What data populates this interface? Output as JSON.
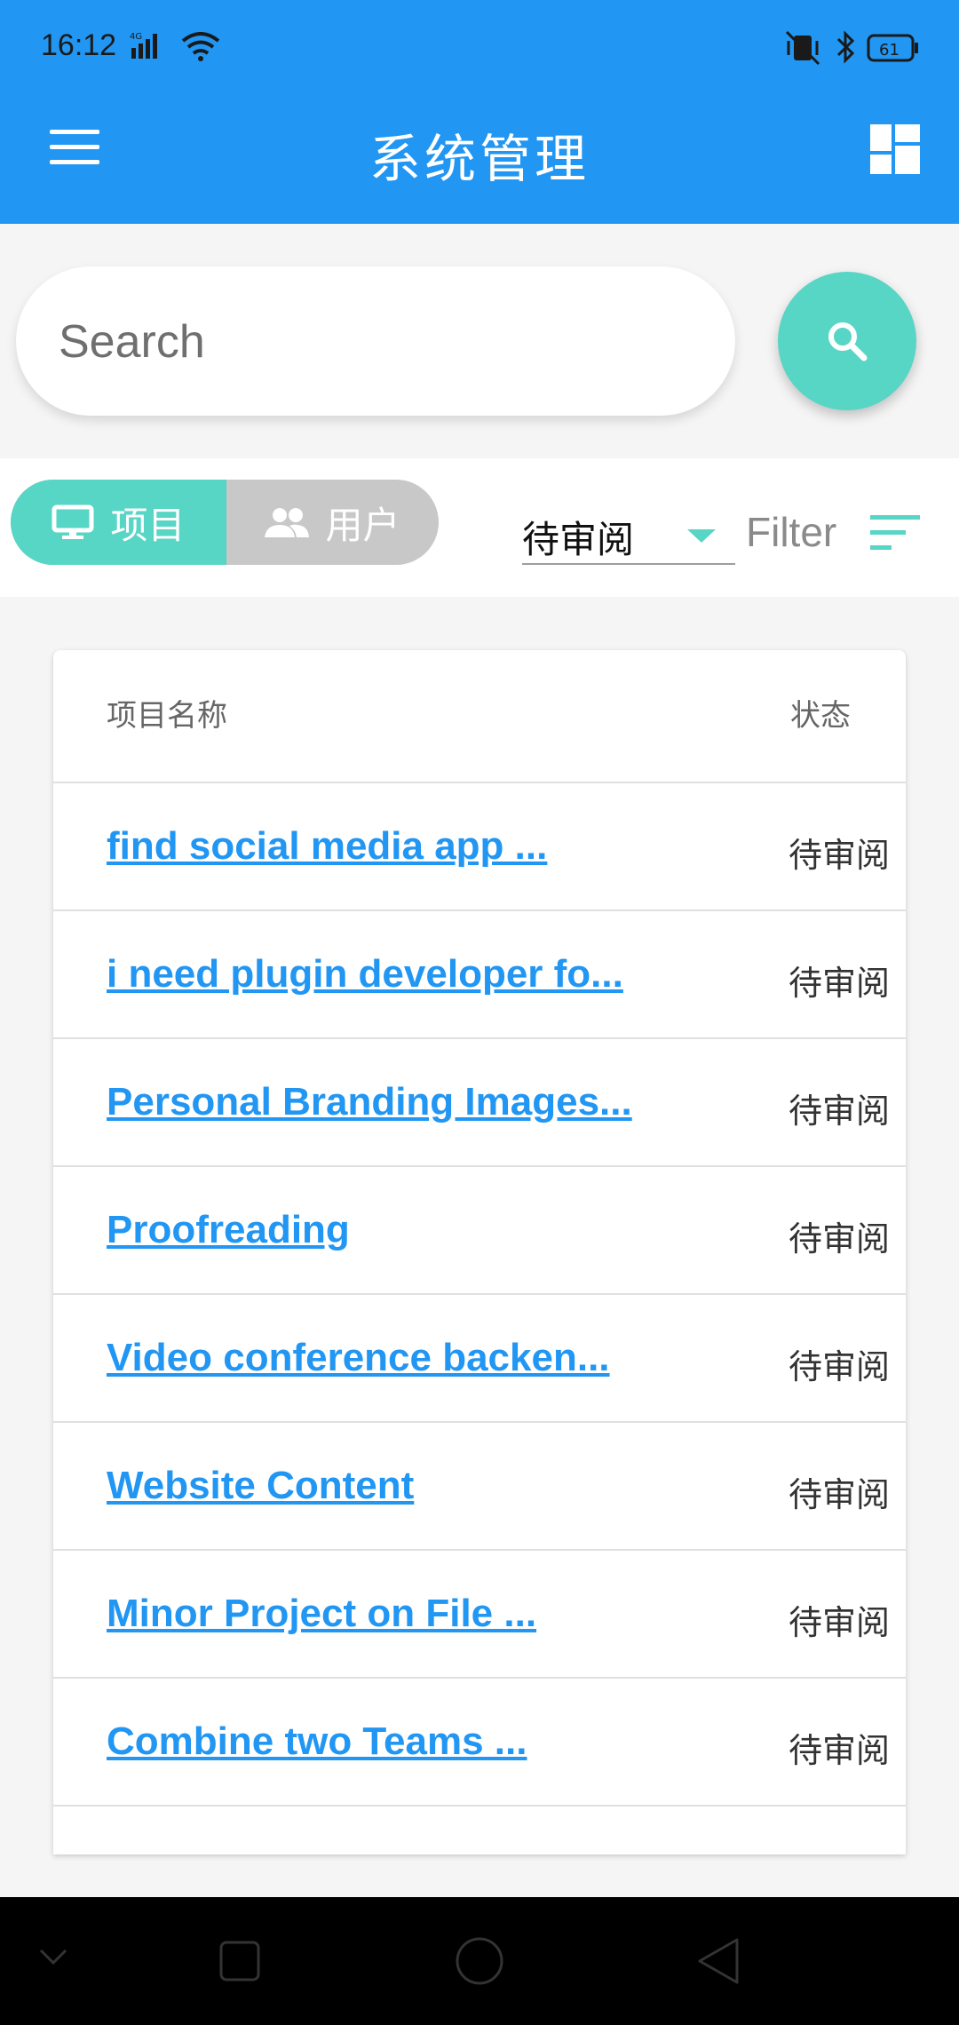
{
  "status_bar": {
    "time": "16:12",
    "network": "4G",
    "battery": "61"
  },
  "app_bar": {
    "title": "系统管理",
    "menu_icon": "hamburger-icon",
    "action_icon": "dashboard-icon"
  },
  "search": {
    "placeholder": "Search",
    "value": "",
    "button_icon": "search-icon"
  },
  "toolbar": {
    "tabs": [
      {
        "label": "项目",
        "icon": "monitor-icon",
        "active": true
      },
      {
        "label": "用户",
        "icon": "people-icon",
        "active": false
      }
    ],
    "status_select": {
      "value": "待审阅"
    },
    "filter_label": "Filter"
  },
  "table": {
    "headers": {
      "name": "项目名称",
      "status": "状态"
    },
    "rows": [
      {
        "name": "find social media app ...",
        "status": "待审阅"
      },
      {
        "name": "i need plugin developer fo...",
        "status": "待审阅"
      },
      {
        "name": "Personal Branding Images...",
        "status": "待审阅"
      },
      {
        "name": "Proofreading",
        "status": "待审阅"
      },
      {
        "name": "Video conference backen...",
        "status": "待审阅"
      },
      {
        "name": "Website Content",
        "status": "待审阅"
      },
      {
        "name": "Minor Project on File ...",
        "status": "待审阅"
      },
      {
        "name": "Combine two Teams ...",
        "status": "待审阅"
      }
    ]
  },
  "colors": {
    "primary": "#2196f3",
    "accent": "#57d5c5",
    "inactive_tab": "#c8c8c8",
    "link": "#2196f3"
  }
}
